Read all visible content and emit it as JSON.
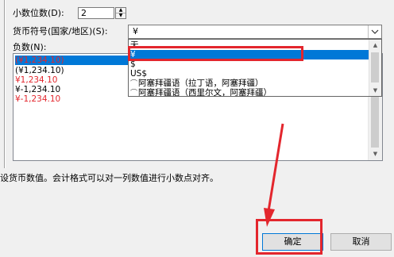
{
  "decimal": {
    "label": "小数位数(D):",
    "value": "2"
  },
  "currency": {
    "label": "货币符号(国家/地区)(S):",
    "value": "¥",
    "options": [
      {
        "text": "无",
        "icon": "",
        "selected": false
      },
      {
        "text": "¥",
        "icon": "",
        "selected": true
      },
      {
        "text": "$",
        "icon": "",
        "selected": false
      },
      {
        "text": "US$",
        "icon": "",
        "selected": false
      },
      {
        "text": "阿塞拜疆语（拉丁语，阿塞拜疆）",
        "icon": "locale-icon",
        "selected": false
      },
      {
        "text": "阿塞拜疆语（西里尔文，阿塞拜疆）",
        "icon": "locale-icon",
        "selected": false
      }
    ]
  },
  "negative": {
    "label": "负数(N):",
    "items": [
      {
        "text": "(¥1,234.10)",
        "color": "#e3262d",
        "selected": true
      },
      {
        "text": "(¥1,234.10)",
        "color": "#000000",
        "selected": false
      },
      {
        "text": "¥1,234.10",
        "color": "#e3262d",
        "selected": false
      },
      {
        "text": "¥-1,234.10",
        "color": "#000000",
        "selected": false
      },
      {
        "text": "¥-1,234.10",
        "color": "#e3262d",
        "selected": false
      }
    ]
  },
  "description": "设货币数值。会计格式可以对一列数值进行小数点对齐。",
  "buttons": {
    "ok": "确定",
    "cancel": "取消"
  },
  "colors": {
    "annotation": "#e3262d",
    "selection": "#0078d7"
  }
}
